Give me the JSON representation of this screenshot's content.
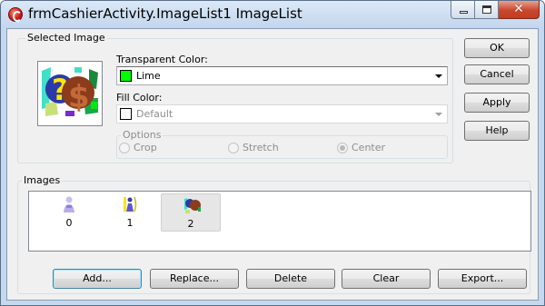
{
  "window": {
    "title": "frmCashierActivity.ImageList1 ImageList"
  },
  "selected_image": {
    "label": "Selected Image"
  },
  "transparent_color": {
    "label": "Transparent Color:",
    "value": "Lime",
    "swatch": "#00ff00"
  },
  "fill_color": {
    "label": "Fill Color:",
    "value": "Default",
    "swatch": "#ffffff"
  },
  "options": {
    "label": "Options",
    "crop": "Crop",
    "stretch": "Stretch",
    "center": "Center",
    "selected": "center"
  },
  "side_buttons": {
    "ok": "OK",
    "cancel": "Cancel",
    "apply": "Apply",
    "help": "Help"
  },
  "images": {
    "label": "Images",
    "items": [
      {
        "caption": "0",
        "icon": "person-icon"
      },
      {
        "caption": "1",
        "icon": "user-chart-icon"
      },
      {
        "caption": "2",
        "icon": "money-question-icon"
      }
    ],
    "selected_index": 2
  },
  "bottom_buttons": {
    "add": "Add...",
    "replace": "Replace...",
    "delete": "Delete",
    "clear": "Clear",
    "export": "Export..."
  }
}
